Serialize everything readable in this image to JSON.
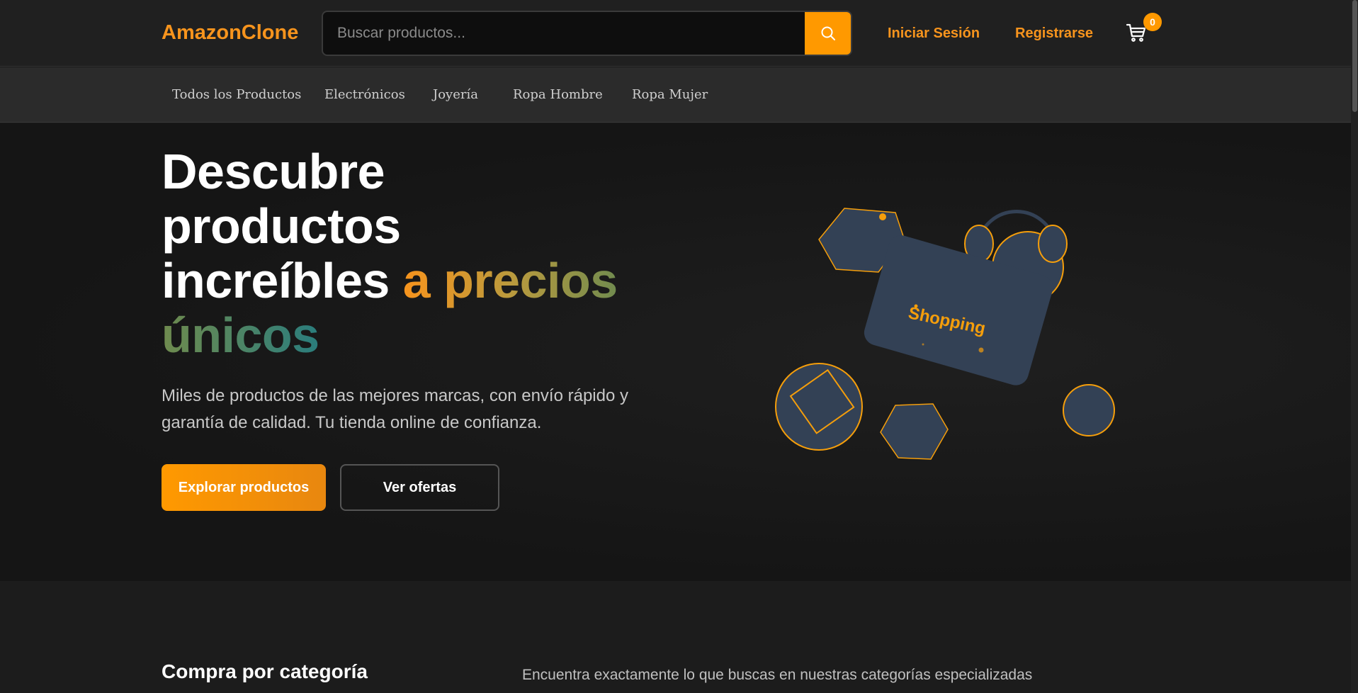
{
  "header": {
    "logo": "AmazonClone",
    "search_placeholder": "Buscar productos...",
    "search_icon": "search-icon",
    "login_label": "Iniciar Sesión",
    "register_label": "Registrarse",
    "cart_icon": "cart-icon",
    "cart_count": "0"
  },
  "categories": {
    "items": [
      {
        "label": "Todos los Productos"
      },
      {
        "label": "Electrónicos"
      },
      {
        "label": "Joyería"
      },
      {
        "label": "Ropa Hombre"
      },
      {
        "label": "Ropa Mujer"
      }
    ]
  },
  "hero": {
    "title_line1": "Descubre",
    "title_line2": "productos",
    "title_line3": "increíbles",
    "title_accent": "a precios únicos",
    "subtitle": "Miles de productos de las mejores marcas, con envío rápido y garantía de calidad. Tu tienda online de confianza.",
    "primary_button": "Explorar productos",
    "secondary_button": "Ver ofertas",
    "illustration_text": "Shopping"
  },
  "section": {
    "title": "Compra por categoría",
    "description": "Encuentra exactamente lo que buscas en nuestras categorías especializadas"
  },
  "colors": {
    "accent": "#ff9900",
    "background": "#1a1a1a",
    "shape": "#334155"
  }
}
